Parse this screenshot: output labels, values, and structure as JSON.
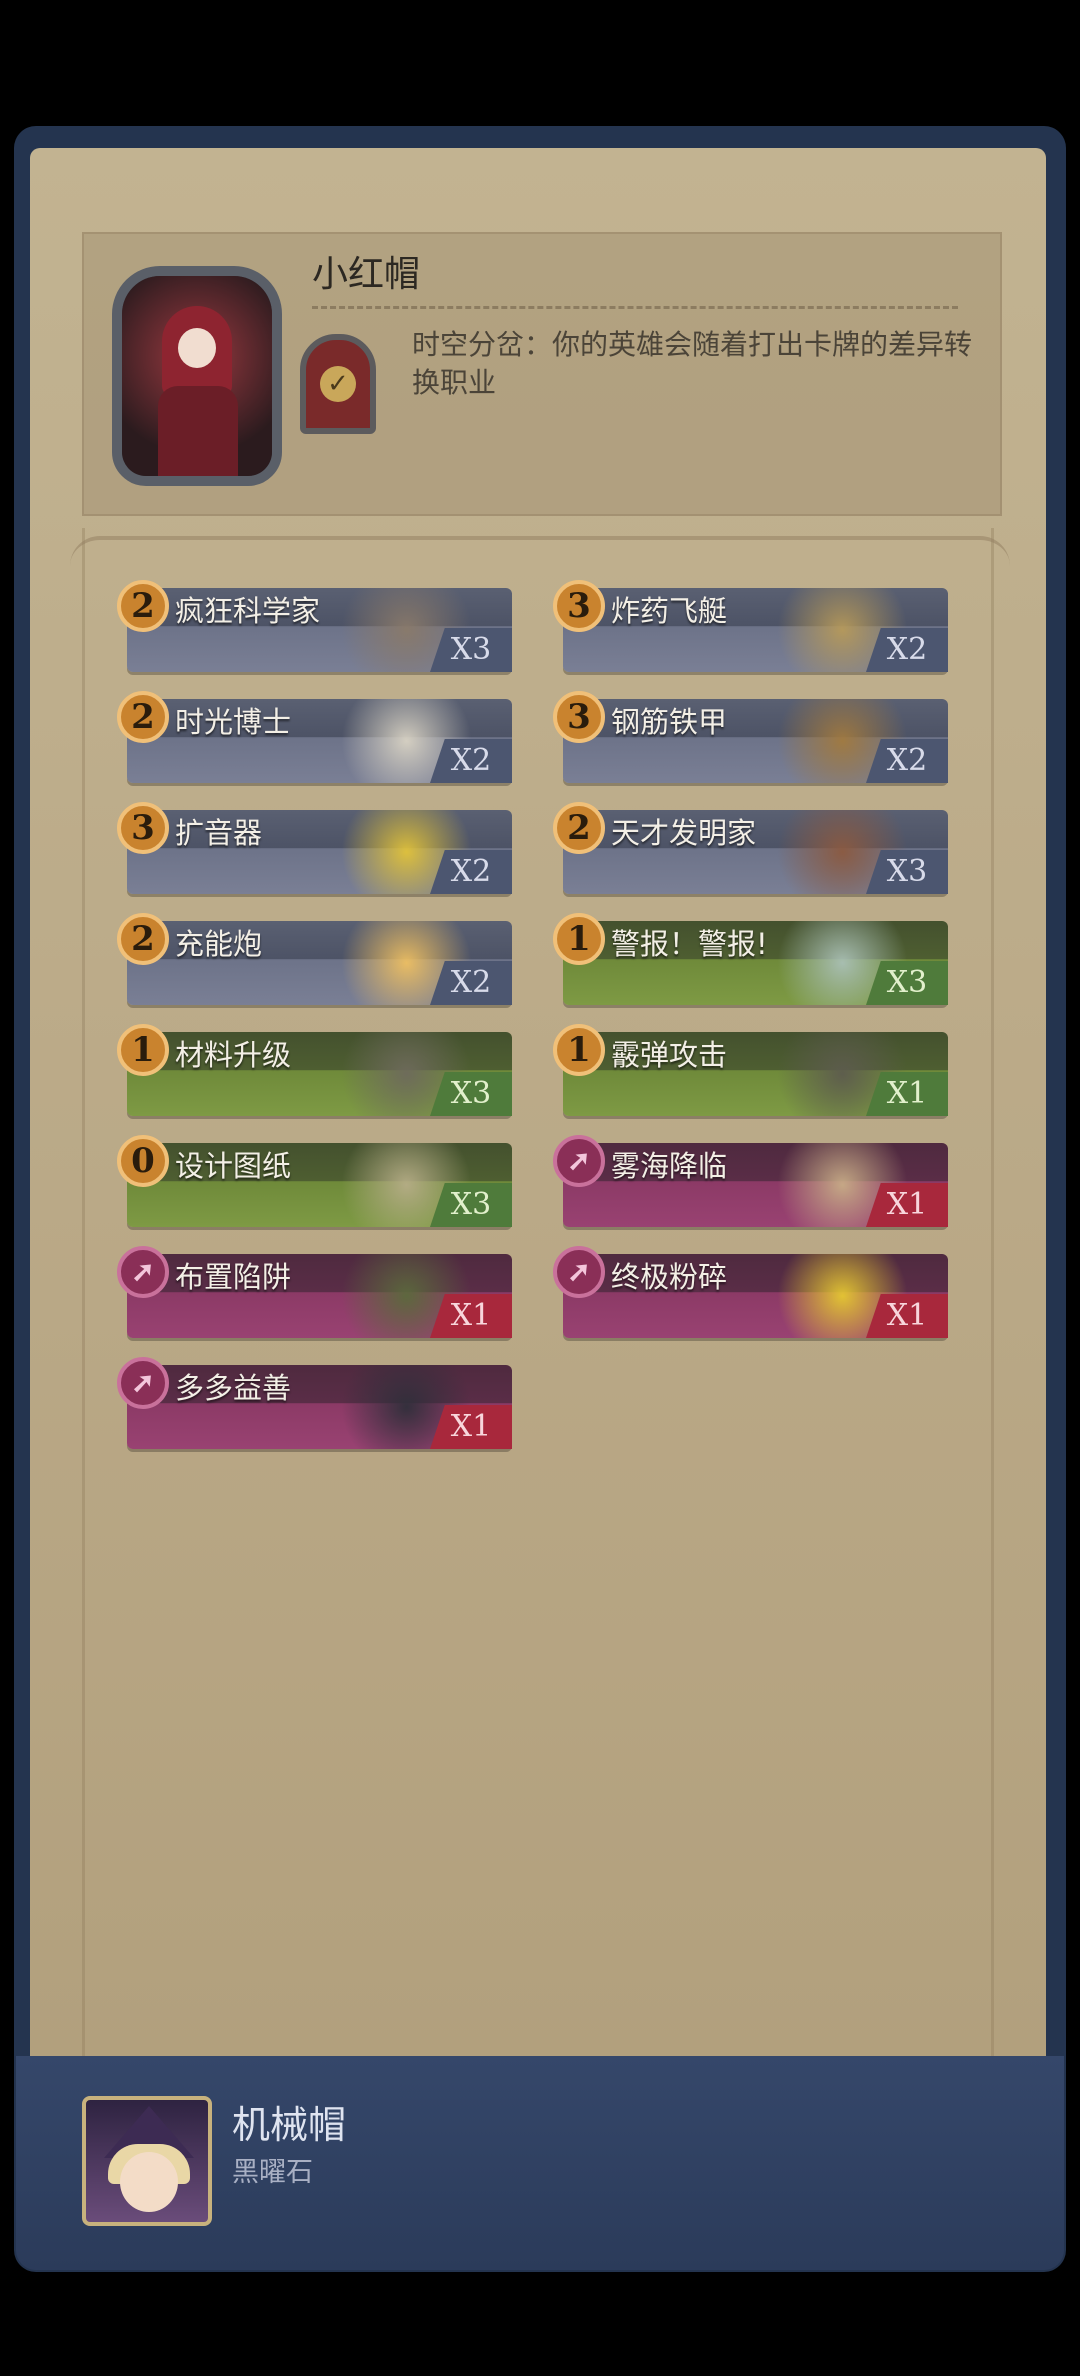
{
  "hero": {
    "name": "小红帽",
    "description": "时空分岔：你的英雄会随着打出卡牌的差异转换职业"
  },
  "cards": [
    {
      "cost": "2",
      "name": "疯狂科学家",
      "count": "X3",
      "style": "gray",
      "art_color": "#8a7a6a"
    },
    {
      "cost": "3",
      "name": "炸药飞艇",
      "count": "X2",
      "style": "gray",
      "art_color": "#b79a5a"
    },
    {
      "cost": "2",
      "name": "时光博士",
      "count": "X2",
      "style": "gray",
      "art_color": "#d9d3c4"
    },
    {
      "cost": "3",
      "name": "钢筋铁甲",
      "count": "X2",
      "style": "gray",
      "art_color": "#a27a3f"
    },
    {
      "cost": "3",
      "name": "扩音器",
      "count": "X2",
      "style": "gray",
      "art_color": "#e2c33a"
    },
    {
      "cost": "2",
      "name": "天才发明家",
      "count": "X3",
      "style": "gray",
      "art_color": "#8c5a40"
    },
    {
      "cost": "2",
      "name": "充能炮",
      "count": "X2",
      "style": "gray",
      "art_color": "#efc062"
    },
    {
      "cost": "1",
      "name": "警报！警报!",
      "count": "X3",
      "style": "green",
      "art_color": "#aac0b6"
    },
    {
      "cost": "1",
      "name": "材料升级",
      "count": "X3",
      "style": "green",
      "art_color": "#6e6a5c"
    },
    {
      "cost": "1",
      "name": "霰弹攻击",
      "count": "X1",
      "style": "green",
      "art_color": "#5d5b4e"
    },
    {
      "cost": "0",
      "name": "设计图纸",
      "count": "X3",
      "style": "green",
      "art_color": "#b6ad87"
    },
    {
      "cost": "",
      "name": "雾海降临",
      "count": "X1",
      "style": "pink",
      "art_color": "#c8ad87"
    },
    {
      "cost": "",
      "name": "布置陷阱",
      "count": "X1",
      "style": "pink",
      "art_color": "#5b6a3c"
    },
    {
      "cost": "",
      "name": "终极粉碎",
      "count": "X1",
      "style": "pink",
      "art_color": "#e6c931"
    },
    {
      "cost": "",
      "name": "多多益善",
      "count": "X1",
      "style": "pink",
      "art_color": "#2f2f3a"
    }
  ],
  "footer": {
    "name": "机械帽",
    "subtitle": "黑曜石"
  }
}
